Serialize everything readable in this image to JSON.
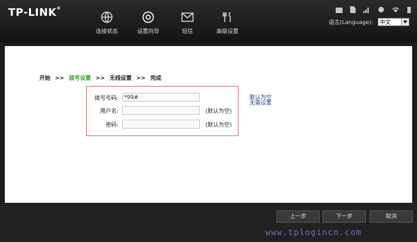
{
  "brand": "TP-LINK",
  "nav": [
    {
      "label": "连接状态",
      "icon": "globe-icon"
    },
    {
      "label": "设置向导",
      "icon": "gear-icon"
    },
    {
      "label": "短信",
      "icon": "envelope-icon"
    },
    {
      "label": "高级设置",
      "icon": "tools-icon"
    }
  ],
  "language": {
    "label": "语言(Language):",
    "selected": "中文"
  },
  "steps": [
    {
      "label": "开始",
      "active": false
    },
    {
      "label": "拨号设置",
      "active": true
    },
    {
      "label": "无线设置",
      "active": false
    },
    {
      "label": "完成",
      "active": false
    }
  ],
  "step_separator": ">>",
  "form": {
    "dial_number": {
      "label": "拨号号码:",
      "value": "*99#"
    },
    "username": {
      "label": "用户名:",
      "value": "",
      "note": "(默认为空)"
    },
    "password": {
      "label": "密码:",
      "value": "",
      "note": "(默认为空)"
    }
  },
  "side_note": {
    "line1": "默认为空",
    "line2": "无需设置"
  },
  "buttons": {
    "prev": "上一步",
    "next": "下一步",
    "cancel": "取消"
  },
  "watermark": "www.tplogincn.com",
  "colors": {
    "active_step": "#3fa02a",
    "header_bg": "#1a1a1a",
    "form_border": "#cc7777"
  }
}
